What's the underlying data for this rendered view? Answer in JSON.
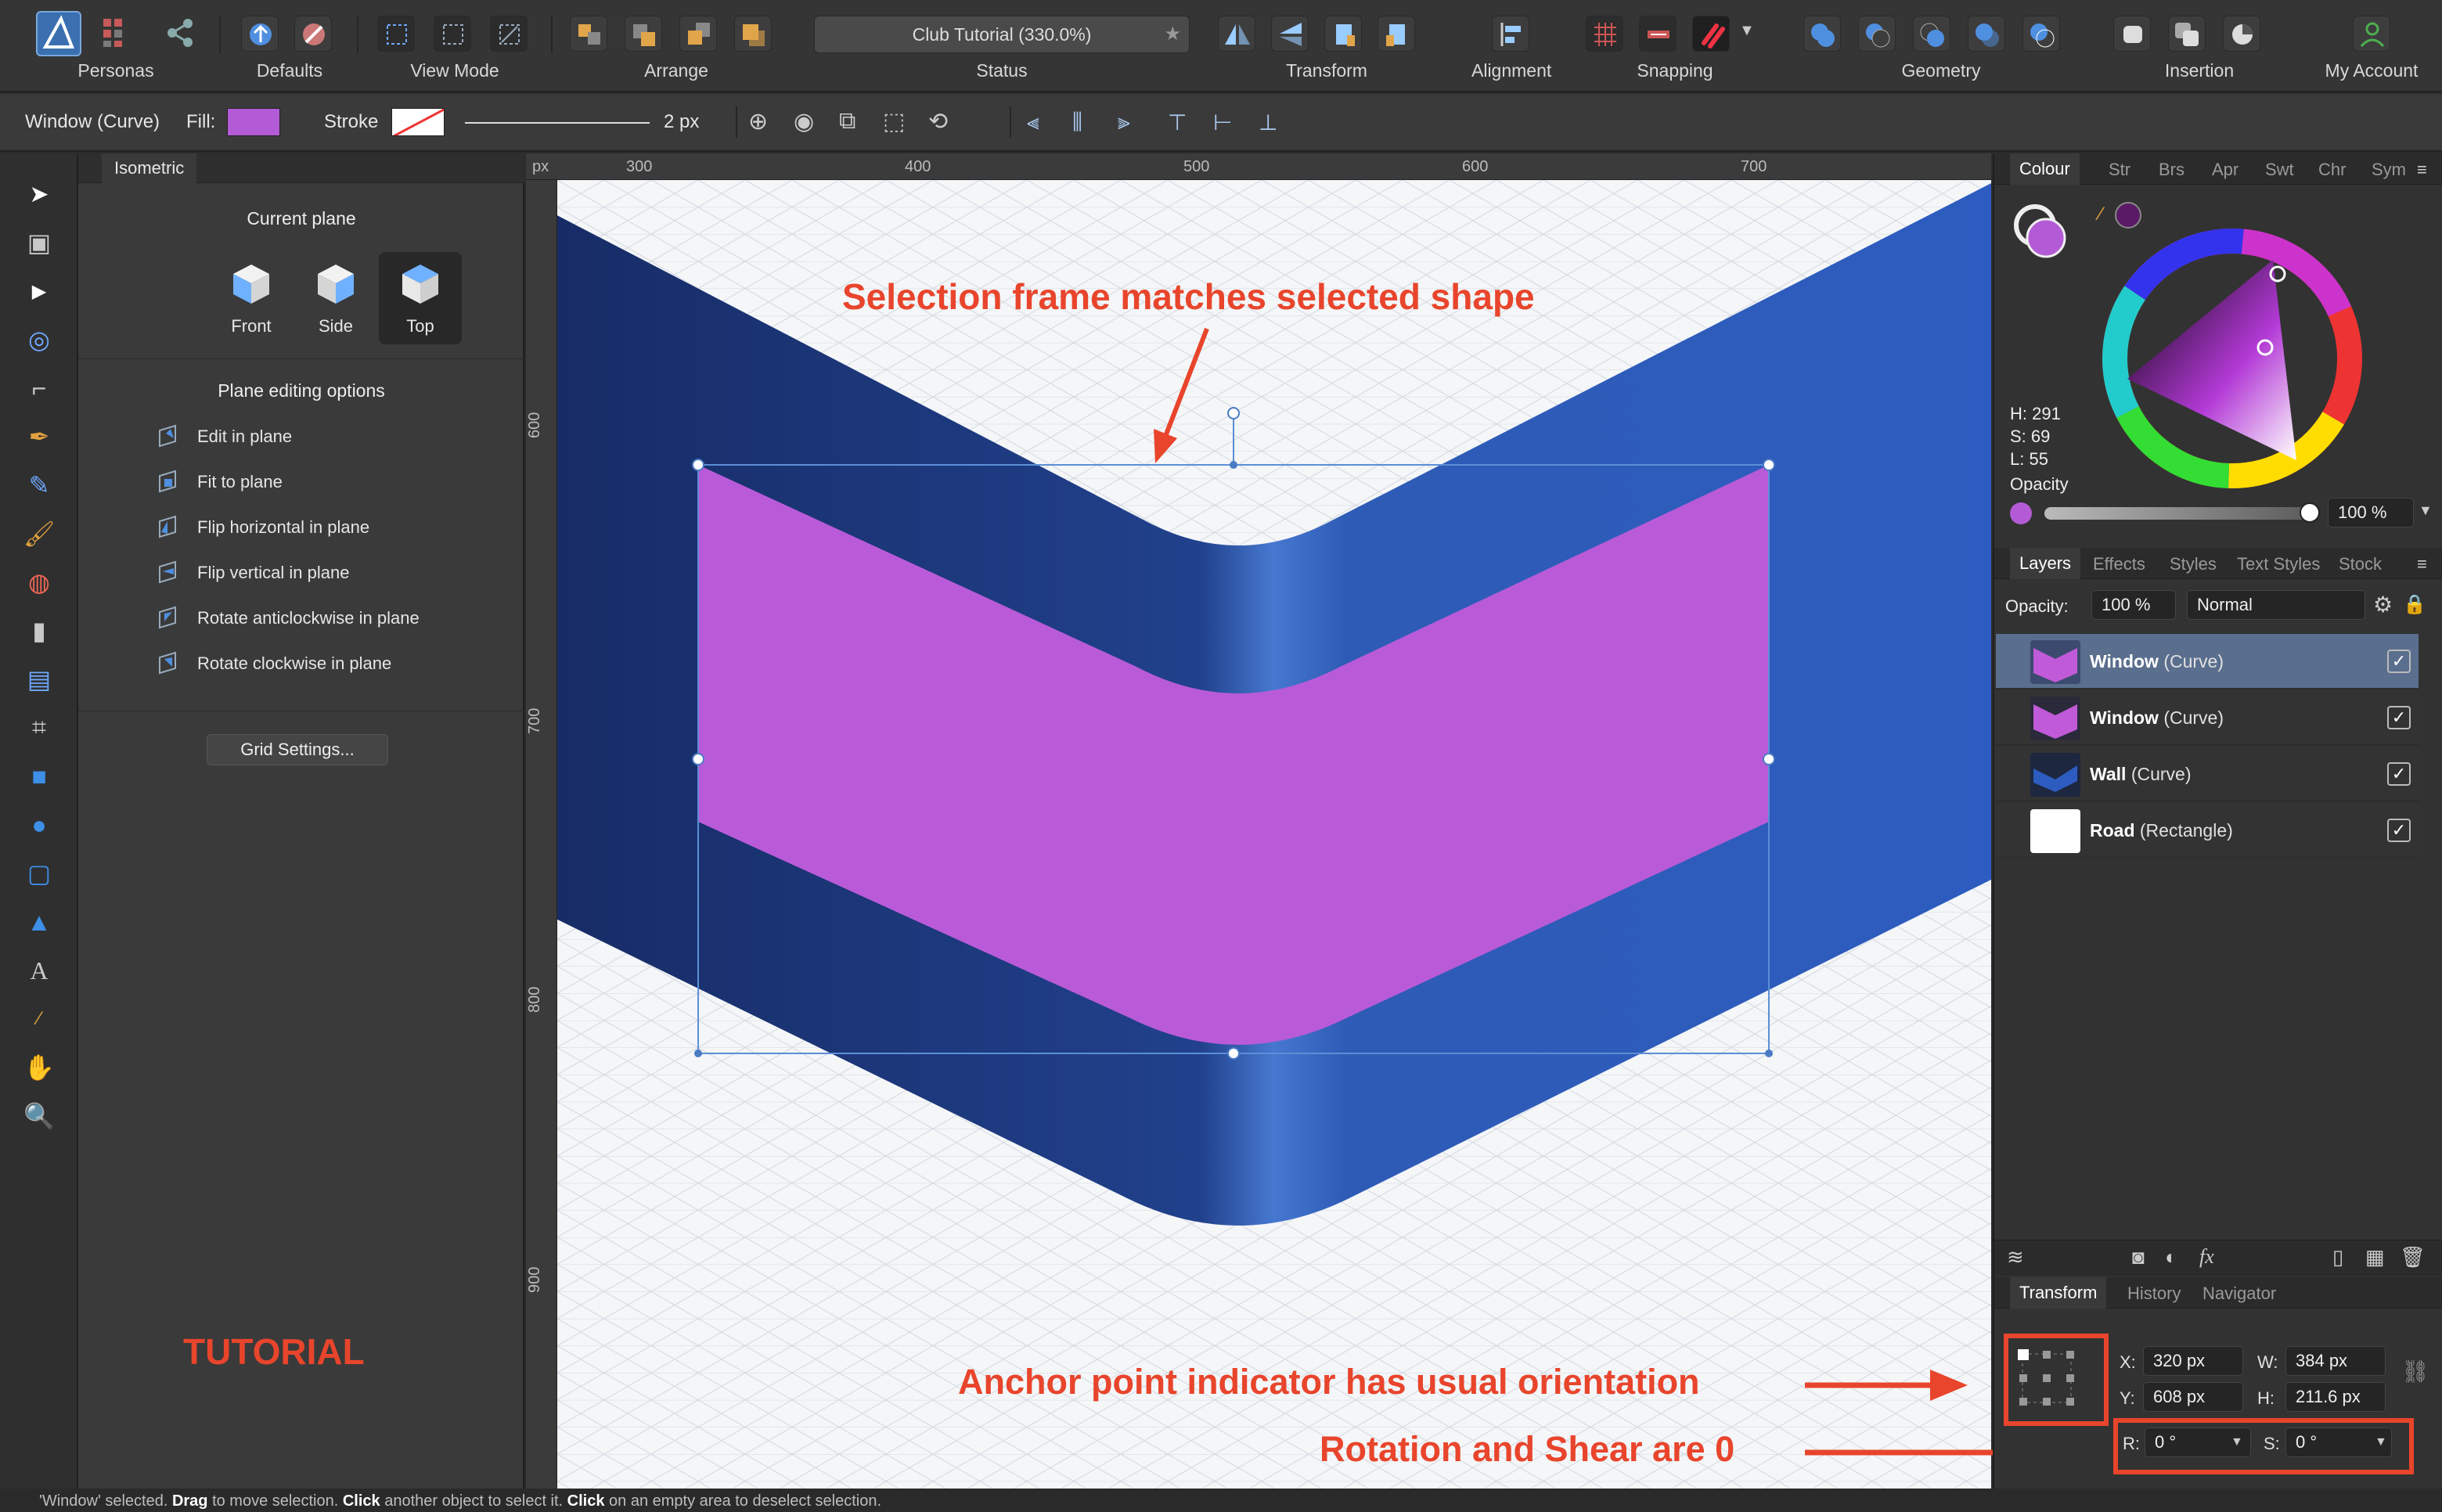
{
  "toolbar": {
    "groups": [
      "Personas",
      "Defaults",
      "View Mode",
      "Arrange",
      "Status",
      "Transform",
      "Alignment",
      "Snapping",
      "Geometry",
      "Insertion",
      "My Account"
    ],
    "document_title": "Club Tutorial (330.0%)",
    "accent": "#2f86e0"
  },
  "context": {
    "selection_label": "Window (Curve)",
    "fill_label": "Fill:",
    "stroke_label": "Stroke",
    "stroke_width": "2 px",
    "fill_color": "#b35bd6"
  },
  "tools": {
    "icons": [
      "move-tool-icon",
      "artboard-tool-icon",
      "node-tool-icon",
      "point-transform-icon",
      "corner-tool-icon",
      "pen-tool-icon",
      "pencil-tool-icon",
      "brush-tool-icon",
      "fill-tool-icon",
      "transparency-tool-icon",
      "place-image-icon",
      "crop-tool-icon",
      "rectangle-tool-icon",
      "ellipse-tool-icon",
      "rounded-rect-icon",
      "triangle-tool-icon",
      "text-tool-icon",
      "color-picker-icon",
      "hand-tool-icon",
      "zoom-tool-icon"
    ]
  },
  "isometric": {
    "tab": "Isometric",
    "current_plane_title": "Current plane",
    "planes": [
      {
        "label": "Front",
        "selected": false
      },
      {
        "label": "Side",
        "selected": false
      },
      {
        "label": "Top",
        "selected": true
      }
    ],
    "editing_title": "Plane editing options",
    "options": [
      "Edit in plane",
      "Fit to plane",
      "Flip horizontal in plane",
      "Flip vertical in plane",
      "Rotate anticlockwise in plane",
      "Rotate clockwise in plane"
    ],
    "grid_button": "Grid Settings..."
  },
  "ruler": {
    "unit": "px",
    "h_ticks": [
      "300",
      "400",
      "500",
      "600",
      "700"
    ],
    "v_ticks": [
      "600",
      "700",
      "800",
      "900"
    ]
  },
  "colour_panel": {
    "tabs": [
      "Colour",
      "Str",
      "Brs",
      "Apr",
      "Swt",
      "Chr",
      "Sym"
    ],
    "hsl": {
      "h": "H: 291",
      "s": "S: 69",
      "l": "L: 55"
    },
    "opacity_label": "Opacity",
    "opacity_value": "100 %",
    "current_color": "#b35bd6"
  },
  "layers_panel": {
    "tabs": [
      "Layers",
      "Effects",
      "Styles",
      "Text Styles",
      "Stock"
    ],
    "opacity_label": "Opacity:",
    "opacity_value": "100 %",
    "blend_mode": "Normal",
    "layers": [
      {
        "name": "Window",
        "type": "(Curve)",
        "selected": true,
        "checked": true
      },
      {
        "name": "Window",
        "type": "(Curve)",
        "selected": false,
        "checked": true
      },
      {
        "name": "Wall",
        "type": "(Curve)",
        "selected": false,
        "checked": true
      },
      {
        "name": "Road",
        "type": "(Rectangle)",
        "selected": false,
        "checked": true
      }
    ]
  },
  "transform_panel": {
    "tabs": [
      "Transform",
      "History",
      "Navigator"
    ],
    "x_label": "X:",
    "x_value": "320 px",
    "y_label": "Y:",
    "y_value": "608 px",
    "w_label": "W:",
    "w_value": "384 px",
    "h_label": "H:",
    "h_value": "211.6 px",
    "r_label": "R:",
    "r_value": "0 °",
    "s_label": "S:",
    "s_value": "0 °"
  },
  "annotations": {
    "selection_frame": "Selection frame matches selected shape",
    "anchor": "Anchor point indicator has usual orientation",
    "rotation": "Rotation and Shear are 0",
    "watermark": "TUTORIAL",
    "color": "#e8452c"
  },
  "status_bar": {
    "p1": "'Window' selected. ",
    "b1": "Drag",
    "p2": " to move selection. ",
    "b2": "Click",
    "p3": " another object to select it. ",
    "b3": "Click",
    "p4": " on an empty area to deselect selection."
  }
}
